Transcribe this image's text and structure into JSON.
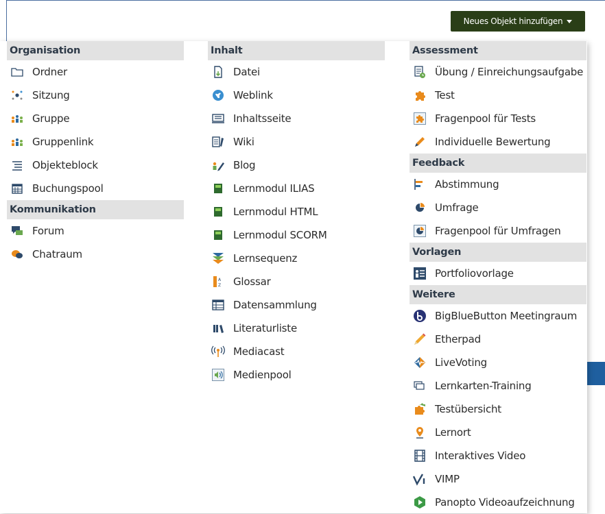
{
  "toolbar": {
    "add_label": "Neues Objekt hinzufügen"
  },
  "columns": [
    {
      "groups": [
        {
          "title": "Organisation",
          "items": [
            {
              "label": "Ordner",
              "icon": "folder-icon"
            },
            {
              "label": "Sitzung",
              "icon": "session-icon"
            },
            {
              "label": "Gruppe",
              "icon": "group-icon"
            },
            {
              "label": "Gruppenlink",
              "icon": "group-link-icon"
            },
            {
              "label": "Objekteblock",
              "icon": "list-icon"
            },
            {
              "label": "Buchungspool",
              "icon": "calendar-icon"
            }
          ]
        },
        {
          "title": "Kommunikation",
          "items": [
            {
              "label": "Forum",
              "icon": "forum-icon"
            },
            {
              "label": "Chatraum",
              "icon": "chat-icon"
            }
          ]
        }
      ]
    },
    {
      "groups": [
        {
          "title": "Inhalt",
          "items": [
            {
              "label": "Datei",
              "icon": "file-download-icon"
            },
            {
              "label": "Weblink",
              "icon": "globe-icon"
            },
            {
              "label": "Inhaltsseite",
              "icon": "page-icon"
            },
            {
              "label": "Wiki",
              "icon": "wiki-icon"
            },
            {
              "label": "Blog",
              "icon": "blog-icon"
            },
            {
              "label": "Lernmodul ILIAS",
              "icon": "module-icon"
            },
            {
              "label": "Lernmodul HTML",
              "icon": "module-icon"
            },
            {
              "label": "Lernmodul SCORM",
              "icon": "module-icon"
            },
            {
              "label": "Lernsequenz",
              "icon": "sequence-icon"
            },
            {
              "label": "Glossar",
              "icon": "glossary-icon"
            },
            {
              "label": "Datensammlung",
              "icon": "table-icon"
            },
            {
              "label": "Literaturliste",
              "icon": "books-icon"
            },
            {
              "label": "Mediacast",
              "icon": "broadcast-icon"
            },
            {
              "label": "Medienpool",
              "icon": "media-pool-icon"
            }
          ]
        }
      ]
    },
    {
      "groups": [
        {
          "title": "Assessment",
          "items": [
            {
              "label": "Übung / Einreichungsaufgabe",
              "icon": "exercise-icon"
            },
            {
              "label": "Test",
              "icon": "puzzle-icon"
            },
            {
              "label": "Fragenpool für Tests",
              "icon": "puzzle-pool-icon"
            },
            {
              "label": "Individuelle Bewertung",
              "icon": "pencil-icon"
            }
          ]
        },
        {
          "title": "Feedback",
          "items": [
            {
              "label": "Abstimmung",
              "icon": "poll-icon"
            },
            {
              "label": "Umfrage",
              "icon": "survey-icon"
            },
            {
              "label": "Fragenpool für Umfragen",
              "icon": "survey-pool-icon"
            }
          ]
        },
        {
          "title": "Vorlagen",
          "items": [
            {
              "label": "Portfoliovorlage",
              "icon": "portfolio-icon"
            }
          ]
        },
        {
          "title": "Weitere",
          "items": [
            {
              "label": "BigBlueButton Meetingraum",
              "icon": "bigbluebutton-icon"
            },
            {
              "label": "Etherpad",
              "icon": "etherpad-pencil-icon"
            },
            {
              "label": "LiveVoting",
              "icon": "livevoting-icon"
            },
            {
              "label": "Lernkarten-Training",
              "icon": "flashcards-icon"
            },
            {
              "label": "Testübersicht",
              "icon": "test-overview-icon"
            },
            {
              "label": "Lernort",
              "icon": "location-pin-icon"
            },
            {
              "label": "Interaktives Video",
              "icon": "film-icon"
            },
            {
              "label": "VIMP",
              "icon": "vimp-icon"
            },
            {
              "label": "Panopto Videoaufzeichnung",
              "icon": "panopto-icon"
            }
          ]
        }
      ]
    }
  ],
  "colors": {
    "button_bg": "#2a3e17",
    "header_bg": "#e2e2e2",
    "frame": "#4a6ea0",
    "accent_blue": "#1f5f9f"
  }
}
